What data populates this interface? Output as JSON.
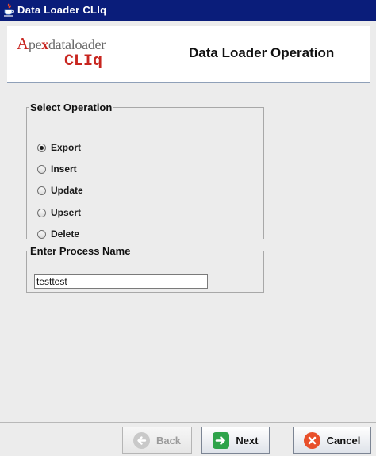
{
  "window": {
    "title": "Data Loader CLIq"
  },
  "header": {
    "logo": {
      "line1": "Apexdataloader",
      "line2": "CLIq"
    },
    "title": "Data Loader Operation"
  },
  "select_operation": {
    "legend": "Select Operation",
    "options": [
      {
        "label": "Export",
        "checked": true
      },
      {
        "label": "Insert",
        "checked": false
      },
      {
        "label": "Update",
        "checked": false
      },
      {
        "label": "Upsert",
        "checked": false
      },
      {
        "label": "Delete",
        "checked": false
      }
    ]
  },
  "process_name": {
    "legend": "Enter Process Name",
    "value": "testtest"
  },
  "buttons": {
    "back": "Back",
    "next": "Next",
    "cancel": "Cancel"
  },
  "icons": {
    "app": "java-cup-icon",
    "back": "arrow-left-icon",
    "next": "arrow-right-icon",
    "cancel": "close-icon"
  },
  "colors": {
    "titlebar": "#0a1d7a",
    "logo_red": "#c8251f",
    "next_green": "#2ea34a",
    "cancel_orange": "#e8502b"
  }
}
